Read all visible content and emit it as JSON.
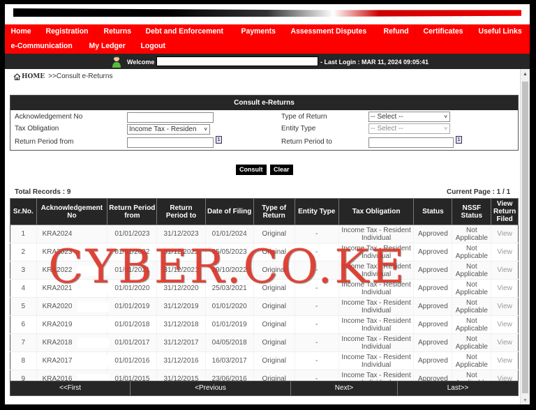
{
  "nav": {
    "row1": [
      "Home",
      "Registration",
      "Returns",
      "Debt and Enforcement",
      "Payments",
      "Assessment Disputes",
      "Refund",
      "Certificates",
      "Useful Links"
    ],
    "row2": [
      "e-Communication",
      "My Ledger",
      "Logout"
    ]
  },
  "welcome": {
    "label": "Welcome",
    "last_login": "- Last Login : MAR 11, 2024 09:05:41"
  },
  "breadcrumb": {
    "home": "HOME",
    "current": ">>Consult e-Returns"
  },
  "form": {
    "title": "Consult e-Returns",
    "ack_label": "Acknowledgement No",
    "ack_value": "",
    "tax_obligation_label": "Tax Obligation",
    "tax_obligation_value": "Income Tax - Residen",
    "period_from_label": "Return Period from",
    "period_from_value": "",
    "type_of_return_label": "Type of Return",
    "type_of_return_value": "-- Select --",
    "entity_type_label": "Entity Type",
    "entity_type_value": "-- Select --",
    "period_to_label": "Return Period to",
    "period_to_value": "",
    "consult_button": "Consult",
    "clear_button": "Clear"
  },
  "results": {
    "total_records": "Total Records : 9",
    "current_page": "Current Page : 1 / 1",
    "columns": [
      "Sr.No.",
      "Acknowledgement No",
      "Return Period from",
      "Return Period to",
      "Date of Filing",
      "Type of Return",
      "Entity Type",
      "Tax Obligation",
      "Status",
      "NSSF Status",
      "View Return Filed"
    ],
    "rows": [
      {
        "sr": "1",
        "ack": "KRA2024",
        "from": "01/01/2023",
        "to": "31/12/2023",
        "filed": "01/01/2024",
        "type": "Original",
        "entity": "-",
        "obligation": "Income Tax - Resident Individual",
        "status": "Approved",
        "nssf": "Not Applicable",
        "view": "View"
      },
      {
        "sr": "2",
        "ack": "KRA2023",
        "from": "01/01/2022",
        "to": "31/12/2022",
        "filed": "05/05/2023",
        "type": "Original",
        "entity": "-",
        "obligation": "Income Tax - Resident Individual",
        "status": "Approved",
        "nssf": "Not Applicable",
        "view": "View"
      },
      {
        "sr": "3",
        "ack": "KRA2022",
        "from": "01/01/2021",
        "to": "31/12/2021",
        "filed": "29/10/2022",
        "type": "Original",
        "entity": "-",
        "obligation": "Income Tax - Resident Individual",
        "status": "Approved",
        "nssf": "Not Applicable",
        "view": "View"
      },
      {
        "sr": "4",
        "ack": "KRA2021",
        "from": "01/01/2020",
        "to": "31/12/2020",
        "filed": "25/03/2021",
        "type": "Original",
        "entity": "-",
        "obligation": "Income Tax - Resident Individual",
        "status": "Approved",
        "nssf": "Not Applicable",
        "view": "View"
      },
      {
        "sr": "5",
        "ack": "KRA2020",
        "from": "01/01/2019",
        "to": "31/12/2019",
        "filed": "01/01/2020",
        "type": "Original",
        "entity": "-",
        "obligation": "Income Tax - Resident Individual",
        "status": "Approved",
        "nssf": "Not Applicable",
        "view": "View"
      },
      {
        "sr": "6",
        "ack": "KRA2019",
        "from": "01/01/2018",
        "to": "31/12/2018",
        "filed": "01/01/2019",
        "type": "Original",
        "entity": "-",
        "obligation": "Income Tax - Resident Individual",
        "status": "Approved",
        "nssf": "Not Applicable",
        "view": "View"
      },
      {
        "sr": "7",
        "ack": "KRA2018",
        "from": "01/01/2017",
        "to": "31/12/2017",
        "filed": "04/05/2018",
        "type": "Original",
        "entity": "-",
        "obligation": "Income Tax - Resident Individual",
        "status": "Approved",
        "nssf": "Not Applicable",
        "view": "View"
      },
      {
        "sr": "8",
        "ack": "KRA2017",
        "from": "01/01/2016",
        "to": "31/12/2016",
        "filed": "16/03/2017",
        "type": "Original",
        "entity": "-",
        "obligation": "Income Tax - Resident Individual",
        "status": "Approved",
        "nssf": "Not Applicable",
        "view": "View"
      },
      {
        "sr": "9",
        "ack": "KRA2016",
        "from": "01/01/2015",
        "to": "31/12/2015",
        "filed": "23/06/2016",
        "type": "Original",
        "entity": "-",
        "obligation": "Income Tax - Resident Individual",
        "status": "Approved",
        "nssf": "Not Applicable",
        "view": "View"
      }
    ]
  },
  "pager": {
    "first": "<<First",
    "previous": "<Previous",
    "next": "Next>",
    "last": "Last>>"
  },
  "watermark": "CYBER.CO.KE",
  "colors": {
    "nav_red": "#ff0000",
    "dark_bar": "#262626",
    "watermark_red": "#e63728"
  }
}
